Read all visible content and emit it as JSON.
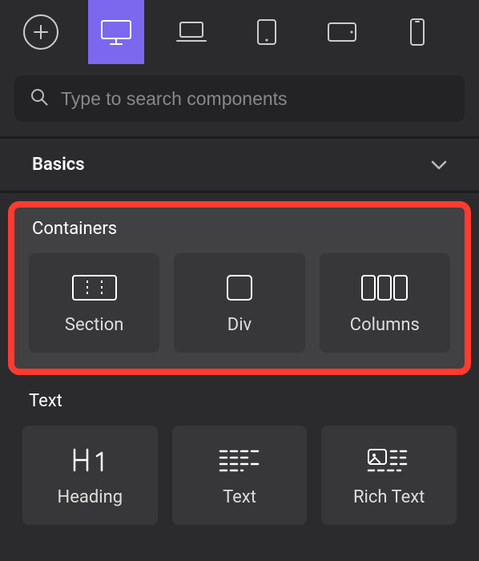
{
  "toolbar": {
    "add_icon": "plus",
    "devices": [
      {
        "name": "desktop",
        "active": true
      },
      {
        "name": "laptop",
        "active": false
      },
      {
        "name": "tablet-portrait",
        "active": false
      },
      {
        "name": "tablet-landscape",
        "active": false
      },
      {
        "name": "phone",
        "active": false
      }
    ]
  },
  "search": {
    "placeholder": "Type to search components",
    "value": ""
  },
  "header": {
    "label": "Basics"
  },
  "groups": {
    "containers": {
      "title": "Containers",
      "highlighted": true,
      "items": [
        {
          "label": "Section",
          "icon": "section"
        },
        {
          "label": "Div",
          "icon": "div"
        },
        {
          "label": "Columns",
          "icon": "columns"
        }
      ]
    },
    "text": {
      "title": "Text",
      "highlighted": false,
      "items": [
        {
          "label": "Heading",
          "icon": "heading"
        },
        {
          "label": "Text",
          "icon": "text"
        },
        {
          "label": "Rich Text",
          "icon": "richtext"
        }
      ]
    }
  },
  "colors": {
    "accent": "#7b68ee",
    "highlight_border": "#ff3b30"
  }
}
